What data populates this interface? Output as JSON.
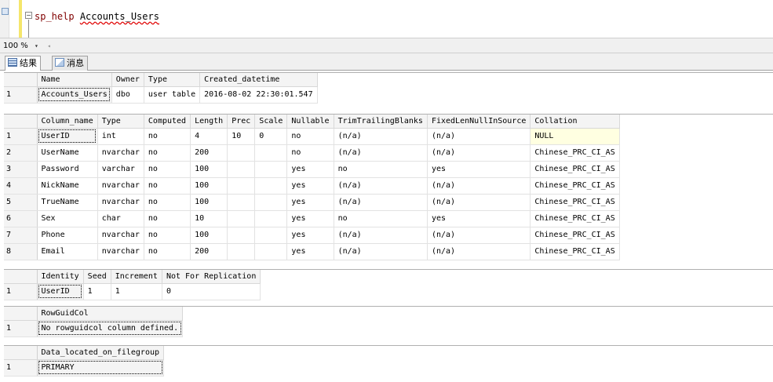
{
  "editor": {
    "keyword": "sp_help",
    "object": "Accounts_Users",
    "collapse_glyph": "−"
  },
  "zoom": {
    "value": "100 %",
    "arrow": "▾",
    "scroll_left": "◂"
  },
  "tabs": [
    {
      "label": "结果",
      "icon": "grid-icon",
      "active": true
    },
    {
      "label": "消息",
      "icon": "message-icon",
      "active": false
    }
  ],
  "grids": {
    "object_info": {
      "columns": [
        "Name",
        "Owner",
        "Type",
        "Created_datetime"
      ],
      "rows": [
        [
          "1",
          "Accounts_Users",
          "dbo",
          "user table",
          "2016-08-02 22:30:01.547"
        ]
      ]
    },
    "columns_info": {
      "columns": [
        "Column_name",
        "Type",
        "Computed",
        "Length",
        "Prec",
        "Scale",
        "Nullable",
        "TrimTrailingBlanks",
        "FixedLenNullInSource",
        "Collation"
      ],
      "rows": [
        [
          "1",
          "UserID",
          "int",
          "no",
          "4",
          "10",
          "0",
          "no",
          "(n/a)",
          "(n/a)",
          "NULL"
        ],
        [
          "2",
          "UserName",
          "nvarchar",
          "no",
          "200",
          "",
          "",
          "no",
          "(n/a)",
          "(n/a)",
          "Chinese_PRC_CI_AS"
        ],
        [
          "3",
          "Password",
          "varchar",
          "no",
          "100",
          "",
          "",
          "yes",
          "no",
          "yes",
          "Chinese_PRC_CI_AS"
        ],
        [
          "4",
          "NickName",
          "nvarchar",
          "no",
          "100",
          "",
          "",
          "yes",
          "(n/a)",
          "(n/a)",
          "Chinese_PRC_CI_AS"
        ],
        [
          "5",
          "TrueName",
          "nvarchar",
          "no",
          "100",
          "",
          "",
          "yes",
          "(n/a)",
          "(n/a)",
          "Chinese_PRC_CI_AS"
        ],
        [
          "6",
          "Sex",
          "char",
          "no",
          "10",
          "",
          "",
          "yes",
          "no",
          "yes",
          "Chinese_PRC_CI_AS"
        ],
        [
          "7",
          "Phone",
          "nvarchar",
          "no",
          "100",
          "",
          "",
          "yes",
          "(n/a)",
          "(n/a)",
          "Chinese_PRC_CI_AS"
        ],
        [
          "8",
          "Email",
          "nvarchar",
          "no",
          "200",
          "",
          "",
          "yes",
          "(n/a)",
          "(n/a)",
          "Chinese_PRC_CI_AS"
        ]
      ]
    },
    "identity_info": {
      "columns": [
        "Identity",
        "Seed",
        "Increment",
        "Not For Replication"
      ],
      "rows": [
        [
          "1",
          "UserID",
          "1",
          "1",
          "0"
        ]
      ]
    },
    "rowguid_info": {
      "columns": [
        "RowGuidCol"
      ],
      "rows": [
        [
          "1",
          "No rowguidcol column defined."
        ]
      ]
    },
    "filegroup_info": {
      "columns": [
        "Data_located_on_filegroup"
      ],
      "rows": [
        [
          "1",
          "PRIMARY"
        ]
      ]
    }
  }
}
